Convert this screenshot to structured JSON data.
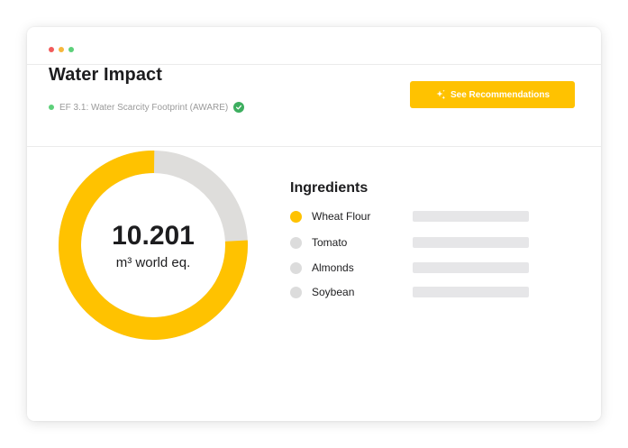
{
  "colors": {
    "accent": "#FFC200",
    "ring_rest": "#DEDDDB",
    "dot_red": "#F15B5B",
    "dot_yellow": "#F6B73C",
    "dot_green": "#5DD07A",
    "status_green": "#5DD07A",
    "check_green": "#3DAE5F",
    "inactive_dot": "#DCDCDC",
    "placeholder_bar": "#E6E6E8"
  },
  "header": {
    "title": "Water Impact",
    "method": "EF 3.1: Water Scarcity Footprint (AWARE)",
    "status_icon": "check-circle-icon",
    "recommend_button": {
      "label": "See Recommendations",
      "icon": "sparkle-icon"
    }
  },
  "summary": {
    "value": "10.201",
    "unit": "m³ world eq.",
    "highlighted_share": 0.76
  },
  "ingredients": {
    "title": "Ingredients",
    "items": [
      {
        "label": "Wheat Flour",
        "active": true
      },
      {
        "label": "Tomato",
        "active": false
      },
      {
        "label": "Almonds",
        "active": false
      },
      {
        "label": "Soybean",
        "active": false
      }
    ]
  }
}
